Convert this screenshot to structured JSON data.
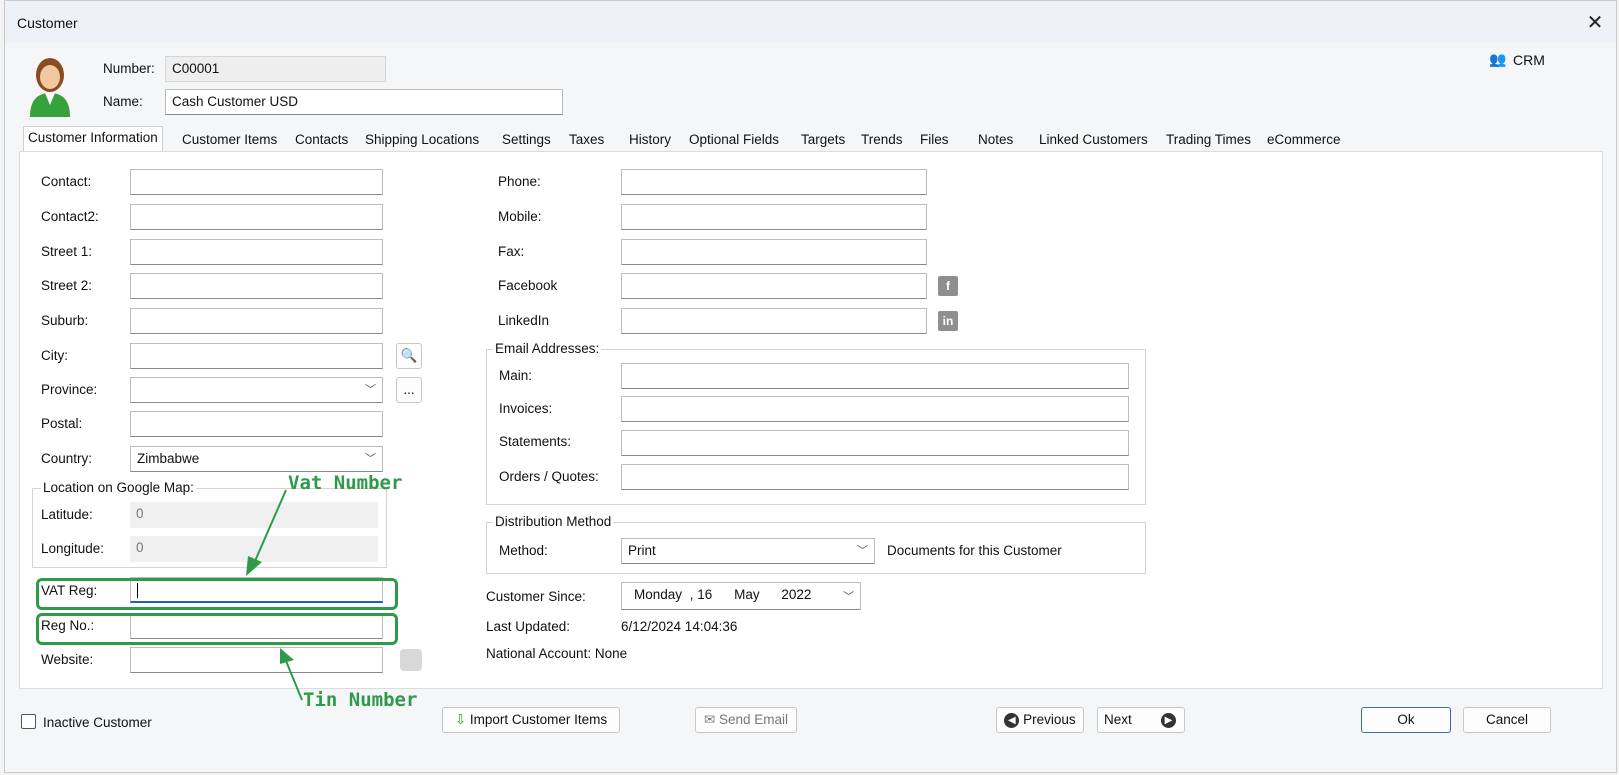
{
  "window": {
    "title": "Customer",
    "close": "✕",
    "crm_label": "CRM"
  },
  "header": {
    "number_label": "Number:",
    "number_value": "C00001",
    "name_label": "Name:",
    "name_value": "Cash Customer USD"
  },
  "tabs": [
    "Customer Information",
    "Customer Items",
    "Contacts",
    "Shipping Locations",
    "Settings",
    "Taxes",
    "History",
    "Optional Fields",
    "Targets",
    "Trends",
    "Files",
    "Notes",
    "Linked Customers",
    "Trading Times",
    "eCommerce"
  ],
  "left": {
    "contact": "Contact:",
    "contact2": "Contact2:",
    "street1": "Street 1:",
    "street2": "Street 2:",
    "suburb": "Suburb:",
    "city": "City:",
    "province": "Province:",
    "province_btn": "...",
    "postal": "Postal:",
    "country": "Country:",
    "country_value": "Zimbabwe",
    "map_group": "Location on Google Map:",
    "latitude": "Latitude:",
    "latitude_value": "0",
    "longitude": "Longitude:",
    "longitude_value": "0",
    "vat": "VAT Reg:",
    "regno": "Reg No.:",
    "website": "Website:"
  },
  "right": {
    "phone": "Phone:",
    "mobile": "Mobile:",
    "fax": "Fax:",
    "facebook": "Facebook",
    "linkedin": "LinkedIn",
    "email_group": "Email Addresses:",
    "main": "Main:",
    "invoices": "Invoices:",
    "statements": "Statements:",
    "orders": "Orders / Quotes:",
    "dist_group": "Distribution Method",
    "method": "Method:",
    "method_value": "Print",
    "method_note": "Documents for this Customer",
    "since": "Customer Since:",
    "since_day": "Monday",
    "since_date": ", 16",
    "since_month": "May",
    "since_year": "2022",
    "updated": "Last Updated:",
    "updated_value": "6/12/2024 14:04:36",
    "national": "National Account: None"
  },
  "annotations": {
    "vat": "Vat Number",
    "tin": "Tin Number"
  },
  "footer": {
    "inactive": "Inactive Customer",
    "import": "Import Customer Items",
    "email": "Send Email",
    "previous": "Previous",
    "next": "Next",
    "ok": "Ok",
    "cancel": "Cancel"
  }
}
